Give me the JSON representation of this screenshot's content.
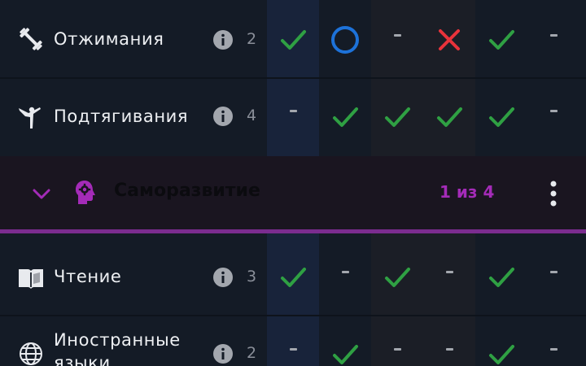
{
  "colors": {
    "background": "#141b26",
    "check": "#2fa043",
    "cross": "#e8333b",
    "circle": "#1d72d9",
    "group_accent": "#a42bb8"
  },
  "habits_top": [
    {
      "name": "Отжимания",
      "icon": "dumbbell-icon",
      "count": "2",
      "days": [
        "check",
        "circle",
        "dash",
        "cross",
        "check",
        "dash"
      ]
    },
    {
      "name": "Подтягивания",
      "icon": "gymnastics-icon",
      "count": "4",
      "days": [
        "dash",
        "check",
        "check",
        "check",
        "check",
        "dash"
      ]
    }
  ],
  "group": {
    "title": "Саморазвитие",
    "icon": "brain-gear-icon",
    "progress": "1 из 4",
    "expanded": true
  },
  "habits_group": [
    {
      "name": "Чтение",
      "icon": "open-book-icon",
      "count": "3",
      "days": [
        "check",
        "dash",
        "check",
        "dash",
        "check",
        "dash"
      ]
    },
    {
      "name_line1": "Иностранные",
      "name_line2": "языки",
      "icon": "globe-icon",
      "count": "2",
      "days": [
        "dash",
        "check",
        "dash",
        "dash",
        "check",
        "dash"
      ]
    }
  ]
}
